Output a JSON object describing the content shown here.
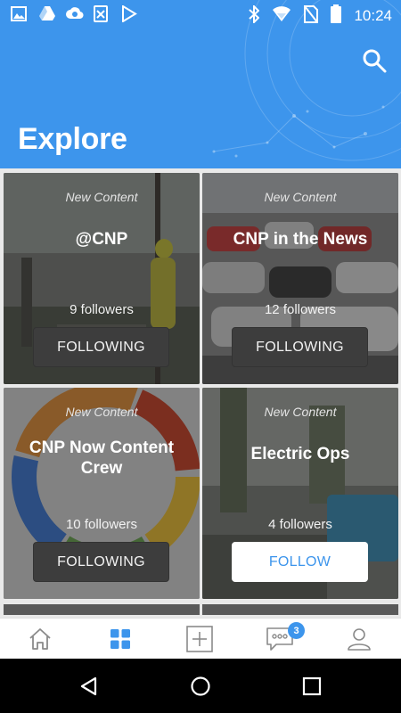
{
  "status_bar": {
    "time": "10:24",
    "left_icons": [
      "image-icon",
      "drive-icon",
      "cloud-sync-icon",
      "spreadsheet-icon",
      "play-store-icon"
    ],
    "right_icons": [
      "bluetooth-icon",
      "wifi-icon",
      "no-sim-icon",
      "battery-icon"
    ]
  },
  "header": {
    "title": "Explore",
    "search_icon": "search-icon",
    "background_color": "#3d95ec"
  },
  "cards": [
    {
      "new_label": "New Content",
      "title": "@CNP",
      "followers": "9 followers",
      "button": "FOLLOWING",
      "state": "following"
    },
    {
      "new_label": "New Content",
      "title": "CNP in the News",
      "followers": "12 followers",
      "button": "FOLLOWING",
      "state": "following"
    },
    {
      "new_label": "New Content",
      "title": "CNP Now Content Crew",
      "followers": "10 followers",
      "button": "FOLLOWING",
      "state": "following"
    },
    {
      "new_label": "New Content",
      "title": "Electric Ops",
      "followers": "4 followers",
      "button": "FOLLOW",
      "state": "follow"
    }
  ],
  "bottom_nav": {
    "items": [
      "home-icon",
      "explore-grid-icon",
      "add-post-icon",
      "messages-icon",
      "profile-icon"
    ],
    "active": "explore-grid-icon",
    "messages_badge": "3",
    "accent_color": "#3d95ec"
  },
  "system_nav": [
    "back-icon",
    "home-circle-icon",
    "recents-icon"
  ]
}
